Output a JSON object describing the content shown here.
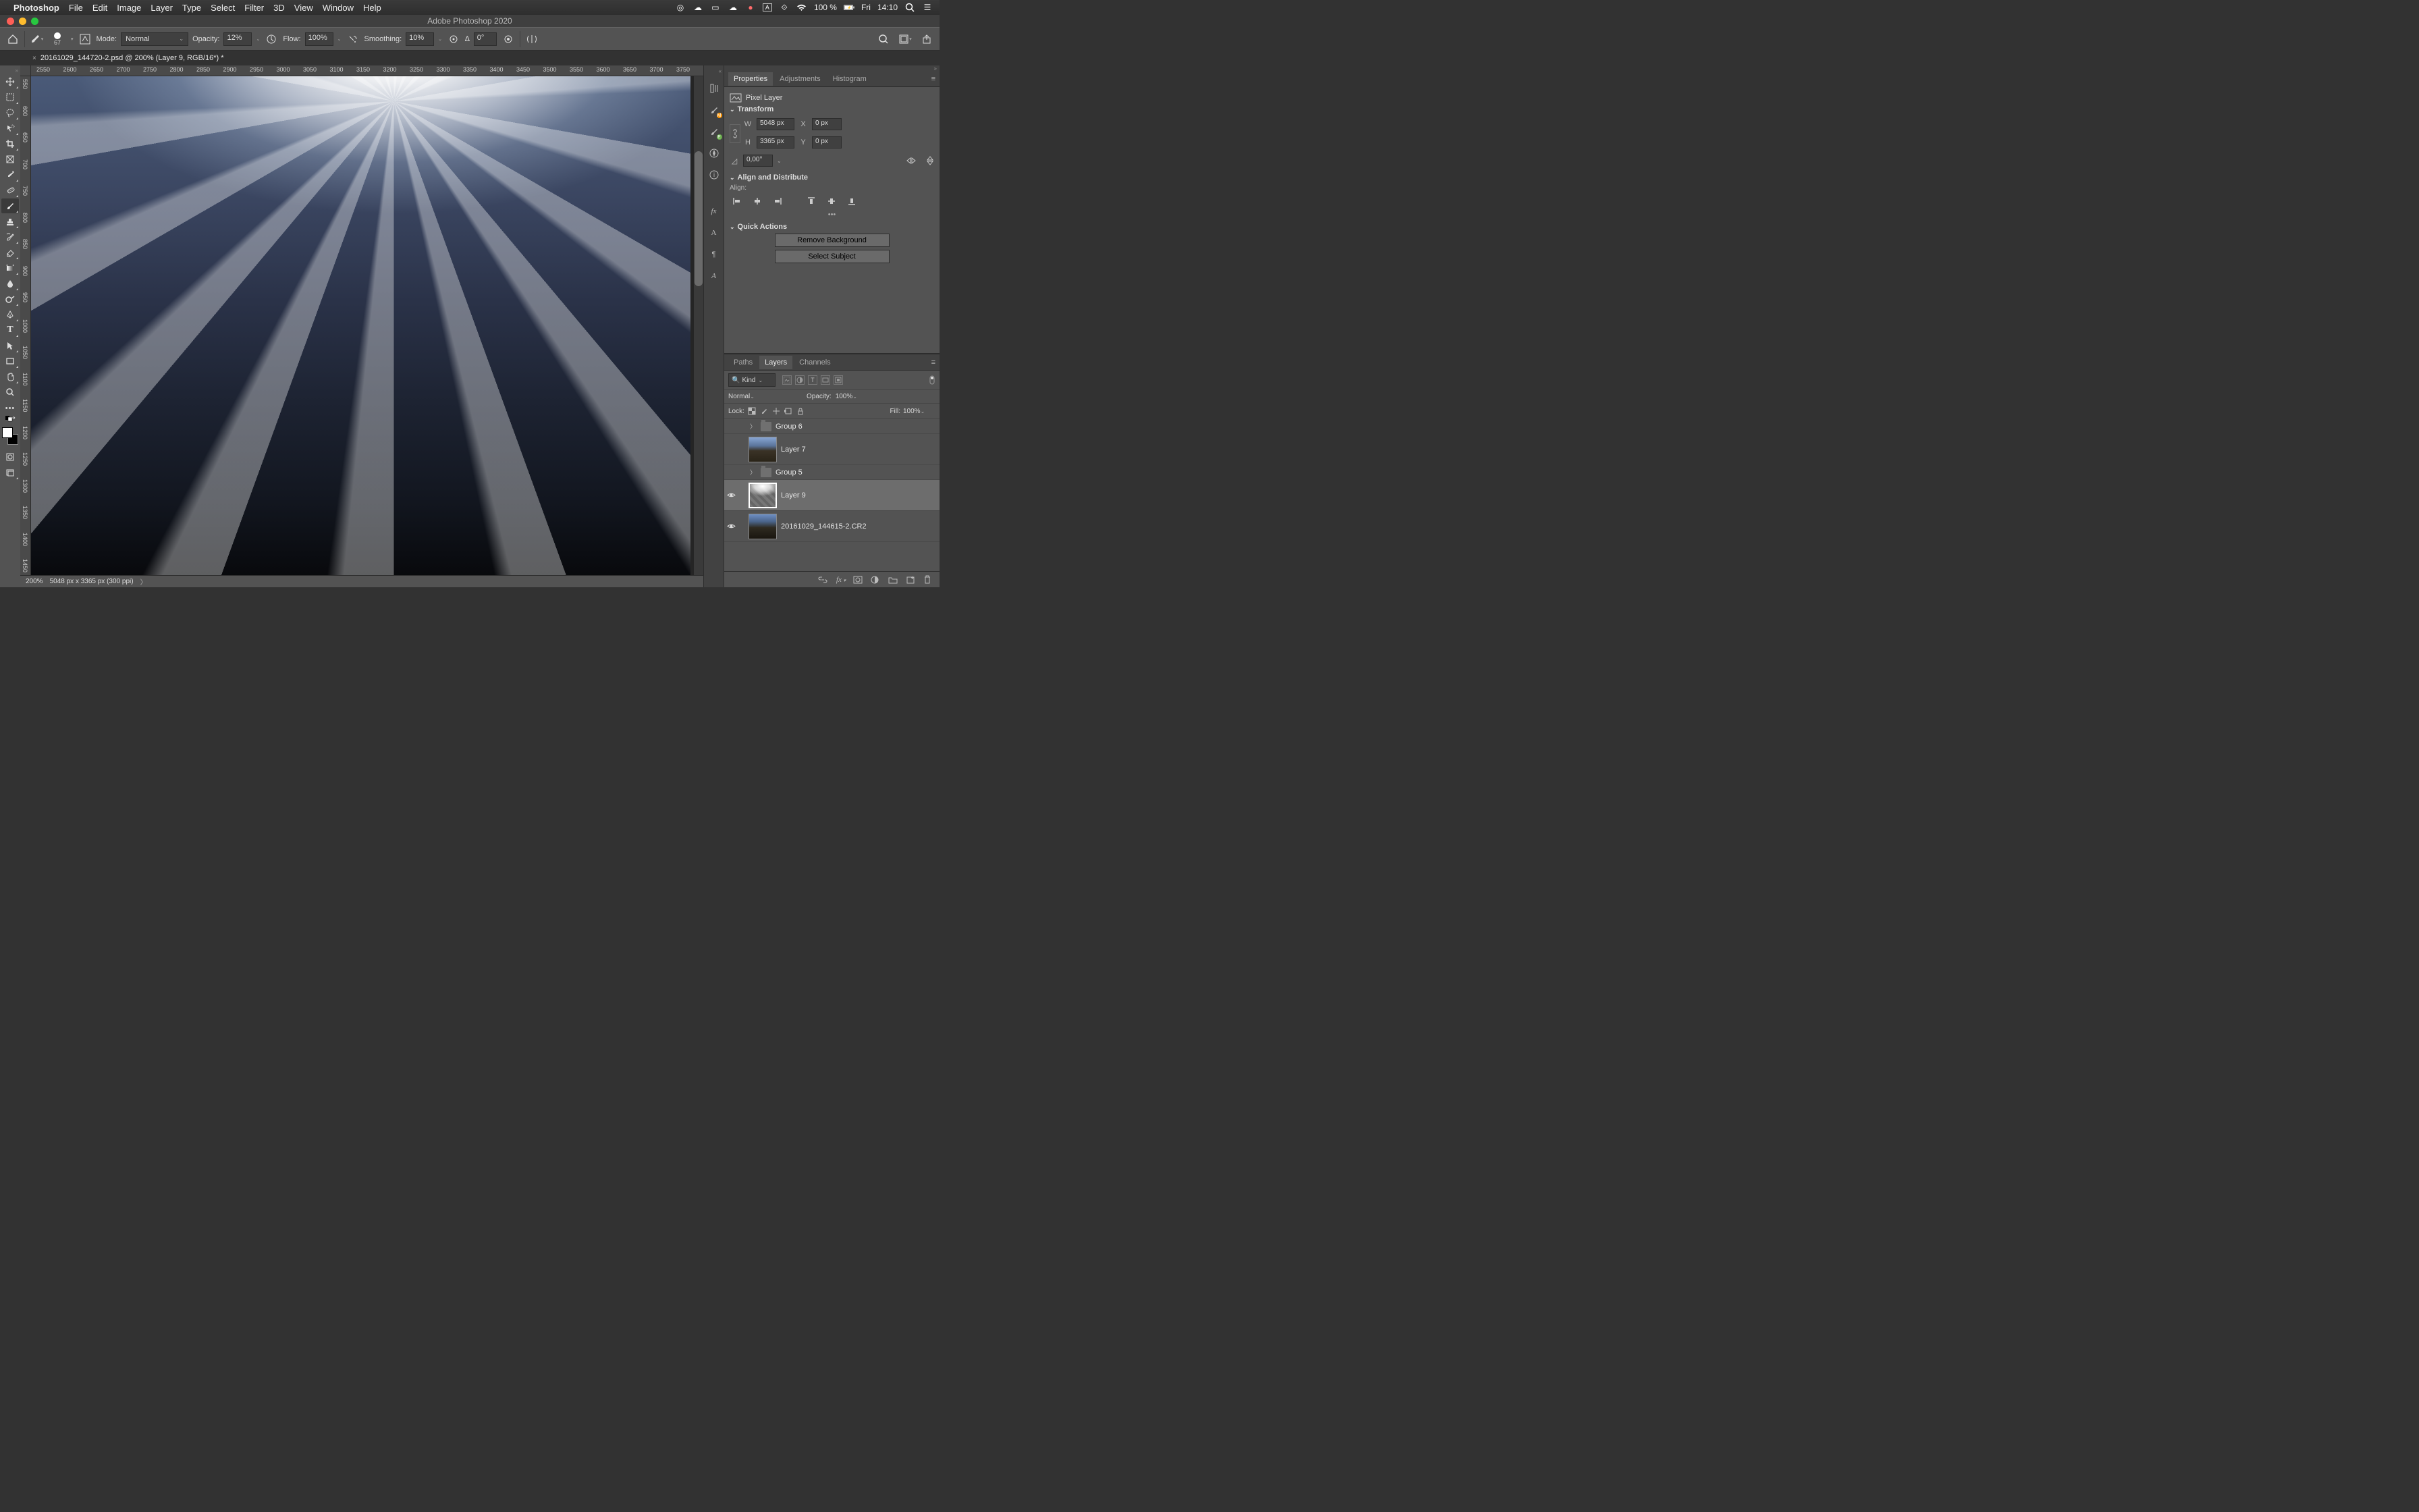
{
  "mac": {
    "app": "Photoshop",
    "menus": [
      "File",
      "Edit",
      "Image",
      "Layer",
      "Type",
      "Select",
      "Filter",
      "3D",
      "View",
      "Window",
      "Help"
    ],
    "battery": "100 %",
    "charging_icon": "⚡",
    "day": "Fri",
    "time": "14:10"
  },
  "title": "Adobe Photoshop 2020",
  "doc_tab": "20161029_144720-2.psd @ 200% (Layer 9, RGB/16*) *",
  "options": {
    "brush_size": "67",
    "mode_label": "Mode:",
    "mode_value": "Normal",
    "opacity_label": "Opacity:",
    "opacity_value": "12%",
    "flow_label": "Flow:",
    "flow_value": "100%",
    "smoothing_label": "Smoothing:",
    "smoothing_value": "10%",
    "angle_label": "∆",
    "angle_value": "0°"
  },
  "ruler_h": [
    "2550",
    "2600",
    "2650",
    "2700",
    "2750",
    "2800",
    "2850",
    "2900",
    "2950",
    "3000",
    "3050",
    "3100",
    "3150",
    "3200",
    "3250",
    "3300",
    "3350",
    "3400",
    "3450",
    "3500",
    "3550",
    "3600",
    "3650",
    "3700",
    "3750"
  ],
  "ruler_v": [
    "550",
    "600",
    "650",
    "700",
    "750",
    "800",
    "850",
    "900",
    "950",
    "1000",
    "1050",
    "1100",
    "1150",
    "1200",
    "1250",
    "1300",
    "1350",
    "1400",
    "1450"
  ],
  "status": {
    "zoom": "200%",
    "dims": "5048 px x 3365 px (300 ppi)"
  },
  "panels": {
    "tabs1": [
      "Properties",
      "Adjustments",
      "Histogram"
    ],
    "pixel_layer": "Pixel Layer",
    "transform": "Transform",
    "W": "5048 px",
    "H": "3365 px",
    "X": "0 px",
    "Y": "0 px",
    "rotate": "0,00°",
    "align_hdr": "Align and Distribute",
    "align_lbl": "Align:",
    "quick_hdr": "Quick Actions",
    "remove_bg": "Remove Background",
    "select_subject": "Select Subject",
    "tabs2": [
      "Paths",
      "Layers",
      "Channels"
    ],
    "kind": "Kind",
    "blend_mode": "Normal",
    "opacity_lbl": "Opacity:",
    "opacity_val": "100%",
    "lock_lbl": "Lock:",
    "fill_lbl": "Fill:",
    "fill_val": "100%"
  },
  "layers": [
    {
      "type": "group",
      "name": "Group 6",
      "visible": false
    },
    {
      "type": "pixel",
      "name": "Layer 7",
      "visible": false,
      "thumb": "photo"
    },
    {
      "type": "group",
      "name": "Group 5",
      "visible": false
    },
    {
      "type": "pixel",
      "name": "Layer 9",
      "visible": true,
      "thumb": "rays",
      "selected": true
    },
    {
      "type": "pixel",
      "name": "20161029_144615-2.CR2",
      "visible": true,
      "thumb": "photo2"
    }
  ]
}
